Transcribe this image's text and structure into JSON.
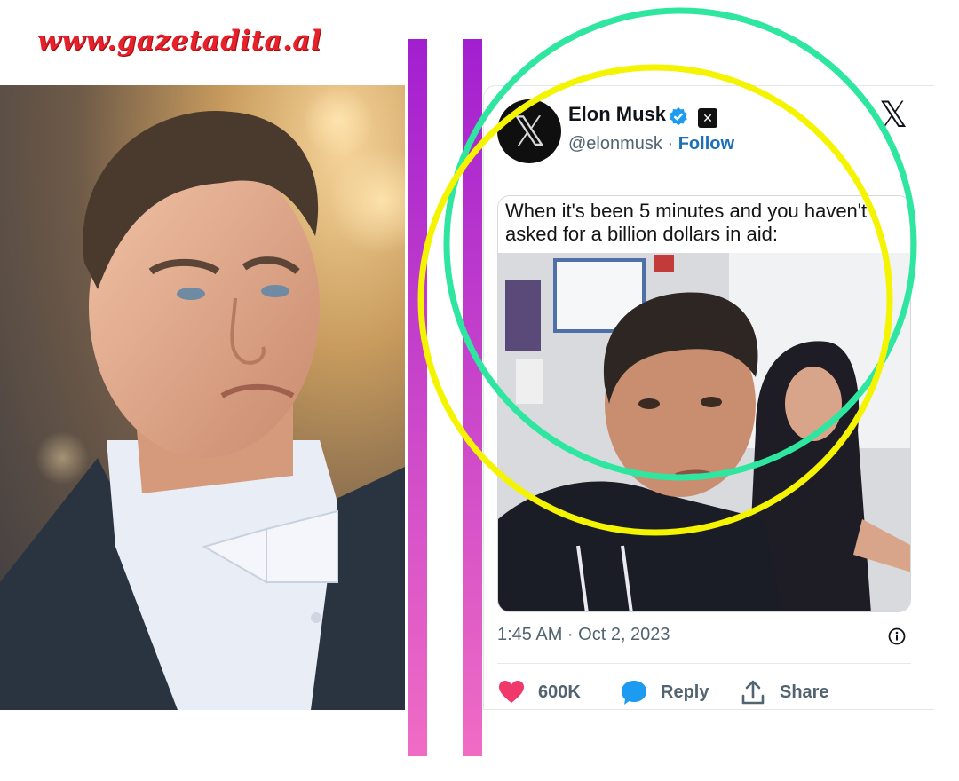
{
  "watermark": "www.gazetadita.al",
  "tweet": {
    "author_name": "Elon Musk",
    "handle": "@elonmusk",
    "separator": "·",
    "follow_label": "Follow",
    "avatar_glyph": "𝕏",
    "close_glyph": "𝕏",
    "meme_caption": "When it's been 5 minutes and you haven't asked for a billion dollars in aid:",
    "timestamp": "1:45 AM · Oct 2, 2023",
    "likes": "600K",
    "reply_label": "Reply",
    "share_label": "Share"
  },
  "icons": {
    "verified": "verified-badge-icon",
    "affiliate": "x-logo-icon",
    "info": "info-icon",
    "like": "heart-icon",
    "reply": "speech-bubble-icon",
    "share": "share-icon"
  },
  "colors": {
    "bar_top": "#a21fd0",
    "bar_bottom": "#f06cc4",
    "ring_green": "#2ee6a0",
    "ring_yellow": "#f4f400",
    "like": "#f0386b",
    "reply": "#1d9bf0",
    "follow": "#1d6fb8",
    "watermark": "#e8202a"
  }
}
